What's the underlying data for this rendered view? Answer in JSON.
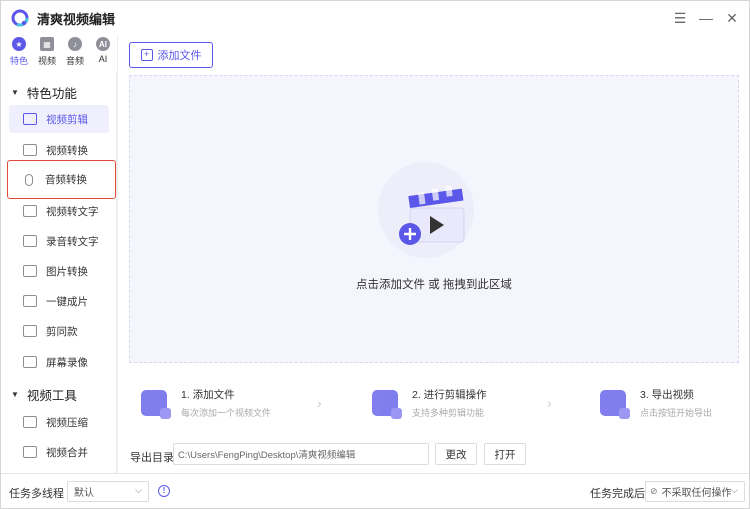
{
  "app": {
    "title": "清爽视频编辑"
  },
  "window_controls": {
    "menu": "☰",
    "minimize": "—",
    "close": "✕"
  },
  "category_tabs": [
    {
      "label": "特色",
      "icon": "star-icon",
      "active": true
    },
    {
      "label": "视频",
      "icon": "film-icon",
      "active": false
    },
    {
      "label": "音频",
      "icon": "music-icon",
      "active": false
    },
    {
      "label": "AI",
      "icon": "ai-icon",
      "active": false
    }
  ],
  "sidebar": {
    "group1": {
      "label": "特色功能"
    },
    "items": [
      {
        "label": "视频剪辑",
        "icon": "film-reel-icon"
      },
      {
        "label": "视频转换",
        "icon": "video-convert-icon"
      },
      {
        "label": "音频转换",
        "icon": "microphone-icon"
      },
      {
        "label": "视频转文字",
        "icon": "video-text-icon"
      },
      {
        "label": "录音转文字",
        "icon": "audio-text-icon"
      },
      {
        "label": "图片转换",
        "icon": "image-icon"
      },
      {
        "label": "一键成片",
        "icon": "one-click-icon"
      },
      {
        "label": "剪同款",
        "icon": "template-icon"
      },
      {
        "label": "屏幕录像",
        "icon": "screen-record-icon"
      }
    ],
    "group2": {
      "label": "视频工具"
    },
    "items2": [
      {
        "label": "视频压缩",
        "icon": "compress-icon"
      },
      {
        "label": "视频合并",
        "icon": "merge-icon"
      }
    ]
  },
  "toolbar": {
    "add_file_label": "添加文件"
  },
  "drop_zone": {
    "text": "点击添加文件 或 拖拽到此区域"
  },
  "steps": [
    {
      "title": "1. 添加文件",
      "sub": "每次添加一个视频文件"
    },
    {
      "title": "2. 进行剪辑操作",
      "sub": "支持多种剪辑功能"
    },
    {
      "title": "3. 导出视频",
      "sub": "点击按钮开始导出"
    }
  ],
  "output": {
    "label": "导出目录",
    "path": "C:\\Users\\FengPing\\Desktop\\清爽视频编辑",
    "change_label": "更改",
    "open_label": "打开"
  },
  "bottom": {
    "threads_label": "任务多线程",
    "threads_value": "默认",
    "after_label": "任务完成后",
    "after_value": "不采取任何操作"
  },
  "colors": {
    "accent": "#5b57e8",
    "highlight_border": "#e34a3c",
    "drop_bg": "#f5f5fd"
  }
}
